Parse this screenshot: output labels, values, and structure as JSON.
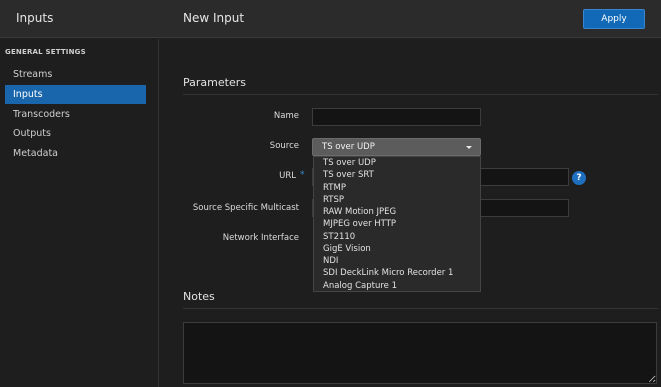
{
  "header": {
    "app_title": "Inputs",
    "page_title": "New Input",
    "apply_label": "Apply"
  },
  "sidebar": {
    "heading": "GENERAL SETTINGS",
    "items": [
      {
        "label": "Streams",
        "active": false
      },
      {
        "label": "Inputs",
        "active": true
      },
      {
        "label": "Transcoders",
        "active": false
      },
      {
        "label": "Outputs",
        "active": false
      },
      {
        "label": "Metadata",
        "active": false
      }
    ]
  },
  "parameters": {
    "title": "Parameters",
    "name_label": "Name",
    "name_value": "",
    "source_label": "Source",
    "source_value": "TS over UDP",
    "url_label": "URL",
    "url_required_mark": "*",
    "ssm_label": "Source Specific Multicast",
    "network_interface_label": "Network Interface"
  },
  "source_options": [
    "TS over UDP",
    "TS over SRT",
    "RTMP",
    "RTSP",
    "RAW Motion JPEG",
    "MJPEG over HTTP",
    "ST2110",
    "GigE Vision",
    "NDI",
    "SDI DeckLink Micro Recorder 1",
    "Analog Capture 1"
  ],
  "help_icon_glyph": "?",
  "notes": {
    "title": "Notes",
    "value": ""
  },
  "colors": {
    "accent": "#1a66ad",
    "background": "#1e1e1e"
  }
}
